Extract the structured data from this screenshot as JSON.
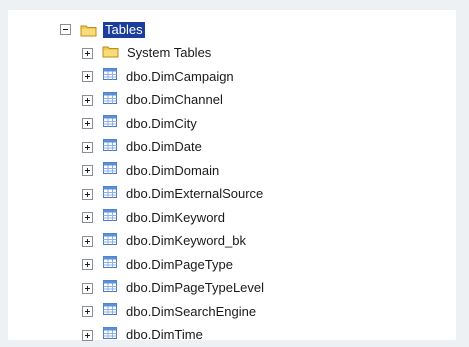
{
  "tree": {
    "root": {
      "label": "Tables",
      "expanded": true,
      "selected": true,
      "icon": "folder-icon"
    },
    "children": [
      {
        "label": "System Tables",
        "icon": "folder-icon"
      },
      {
        "label": "dbo.DimCampaign",
        "icon": "table-icon"
      },
      {
        "label": "dbo.DimChannel",
        "icon": "table-icon"
      },
      {
        "label": "dbo.DimCity",
        "icon": "table-icon"
      },
      {
        "label": "dbo.DimDate",
        "icon": "table-icon"
      },
      {
        "label": "dbo.DimDomain",
        "icon": "table-icon"
      },
      {
        "label": "dbo.DimExternalSource",
        "icon": "table-icon"
      },
      {
        "label": "dbo.DimKeyword",
        "icon": "table-icon"
      },
      {
        "label": "dbo.DimKeyword_bk",
        "icon": "table-icon"
      },
      {
        "label": "dbo.DimPageType",
        "icon": "table-icon"
      },
      {
        "label": "dbo.DimPageTypeLevel",
        "icon": "table-icon"
      },
      {
        "label": "dbo.DimSearchEngine",
        "icon": "table-icon"
      },
      {
        "label": "dbo.DimTime",
        "icon": "table-icon"
      }
    ]
  },
  "colors": {
    "selection": "#1b3d9b",
    "folder": "#f2c94c",
    "table": "#5b8fd6"
  }
}
